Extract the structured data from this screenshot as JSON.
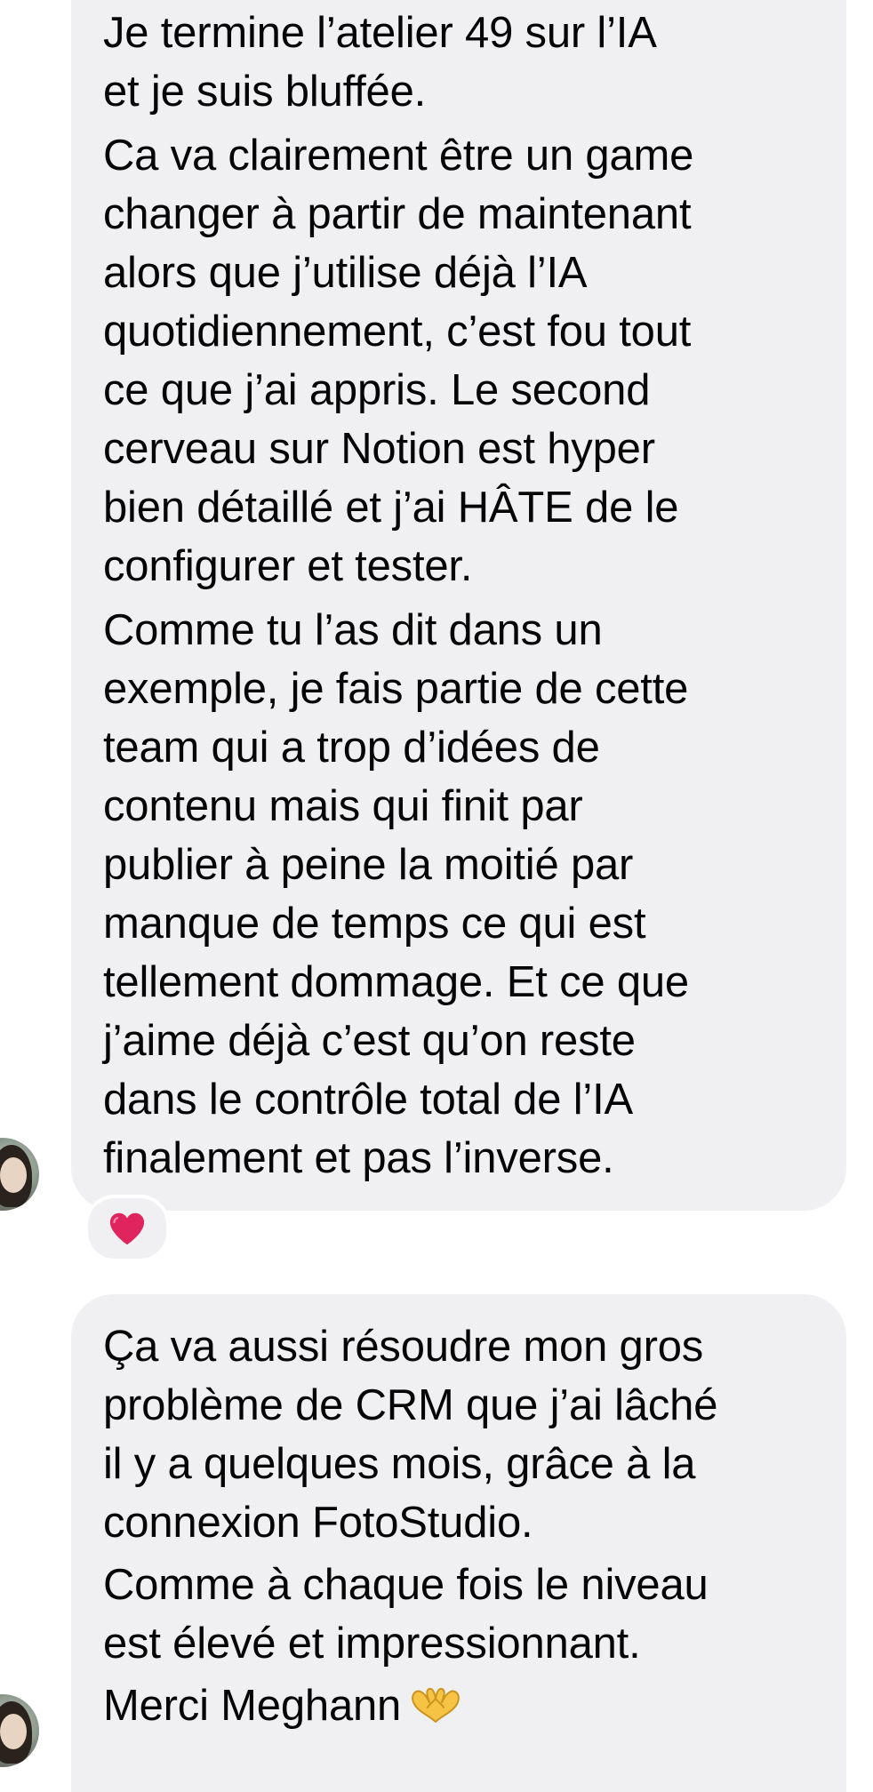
{
  "messages": [
    {
      "paragraphs": [
        "Je termine l’atelier 49 sur l’IA\net je suis bluffée.",
        "Ca va clairement être un game\nchanger à partir de maintenant\nalors que j’utilise déjà l’IA\nquotidiennement, c’est fou tout\nce que j’ai appris. Le second\ncerveau sur Notion est hyper\nbien détaillé et j’ai HÂTE de le\nconfigurer et tester.",
        "Comme tu l’as dit dans un\nexemple, je fais partie de cette\nteam qui a trop d’idées de\ncontenu mais qui finit par\npublier à peine la moitié par\nmanque de temps ce qui est\ntellement dommage. Et ce que\nj’aime déjà c’est qu’on reste\ndans le contrôle total de l’IA\nfinalement et pas l’inverse."
      ],
      "reaction": "heart",
      "reaction_color": "#e0245e"
    },
    {
      "paragraphs": [
        "Ça va aussi résoudre mon gros\nproblème de CRM que j’ai lâché\nil y a quelques mois, grâce à la\nconnexion FotoStudio.",
        "Comme à chaque fois le niveau\nest élevé et impressionnant.",
        "Merci Meghann"
      ],
      "trailing_emoji": "heart-hands"
    }
  ],
  "colors": {
    "bubble": "#f0f0f2",
    "text": "#050505",
    "background": "#ffffff"
  }
}
